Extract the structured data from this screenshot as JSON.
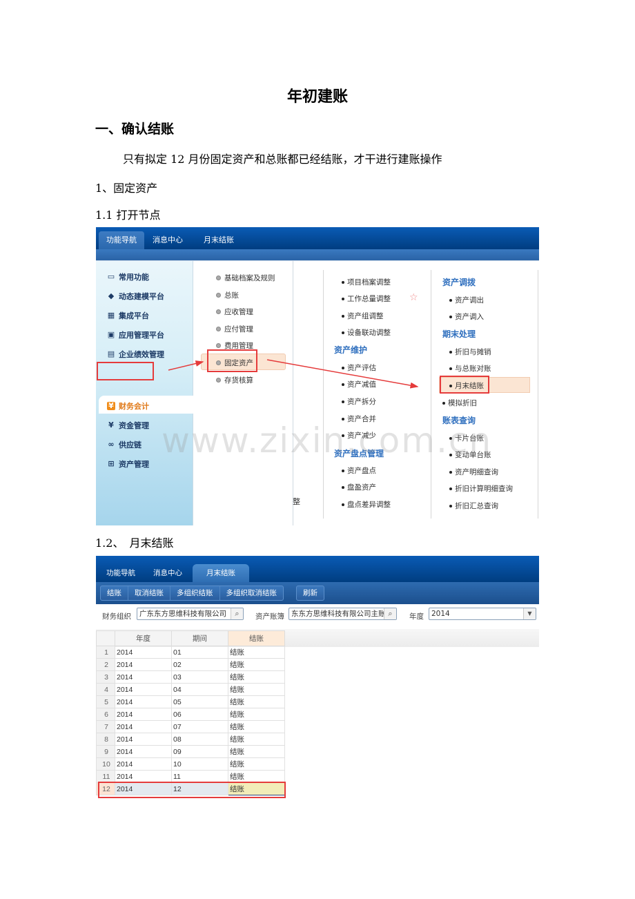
{
  "document": {
    "title": "年初建账",
    "section1": "一、确认结账",
    "intro": "只有拟定 12 月份固定资产和总账都已经结账，才干进行建账操作",
    "step1": "1、固定资产",
    "step1_1": "1.1 打开节点",
    "step1_2": "1.2、　月末结账"
  },
  "shot1": {
    "tabs": [
      "功能导航",
      "消息中心",
      "月末结账"
    ],
    "active_tab": "功能导航",
    "left_nav": [
      {
        "label": "常用功能",
        "icon": "monitor-icon"
      },
      {
        "label": "动态建模平台",
        "icon": "cube-icon"
      },
      {
        "label": "集成平台",
        "icon": "integration-icon"
      },
      {
        "label": "应用管理平台",
        "icon": "app-icon"
      },
      {
        "label": "企业绩效管理",
        "icon": "calculator-icon"
      },
      {
        "label": "财务会计",
        "icon": "yen-icon"
      },
      {
        "label": "资金管理",
        "icon": "yen-icon"
      },
      {
        "label": "供应链",
        "icon": "link-icon"
      },
      {
        "label": "资产管理",
        "icon": "asset-icon"
      }
    ],
    "active_nav": "财务会计",
    "modules": [
      "基础档案及规则",
      "总账",
      "应收管理",
      "应付管理",
      "费用管理",
      "固定资产",
      "存货核算"
    ],
    "active_module": "固定资产",
    "col3": {
      "items_top": [
        "项目档案调整",
        "工作总量调整",
        "资产组调整",
        "设备联动调整"
      ],
      "group_maintain": "资产维护",
      "maintain_items": [
        "资产评估",
        "资产减值",
        "资产拆分",
        "资产合并",
        "资产减少"
      ],
      "group_inventory": "资产盘点管理",
      "inventory_items": [
        "资产盘点",
        "盘盈资产",
        "盘点差异调整"
      ],
      "edge_text": "整"
    },
    "col4": {
      "group_transfer": "资产调拨",
      "transfer_items": [
        "资产调出",
        "资产调入"
      ],
      "group_period": "期末处理",
      "period_items": [
        "折旧与摊销",
        "与总账对账",
        "月末结账"
      ],
      "standalone": "模拟折旧",
      "group_report": "账表查询",
      "report_items": [
        "卡片台账",
        "变动单台账",
        "资产明细查询",
        "折旧计算明细查询",
        "折旧汇总查询"
      ]
    },
    "highlighted_item": "月末结账",
    "watermark": "www.zixin.com.cn"
  },
  "shot2": {
    "tabs": [
      "功能导航",
      "消息中心",
      "月末结账"
    ],
    "active_tab": "月末结账",
    "toolbar_group1": [
      "结账",
      "取消结账",
      "多组织结账",
      "多组织取消结账"
    ],
    "toolbar_refresh": "刷新",
    "filters": {
      "org_label": "财务组织",
      "org_value": "广东东方思维科技有限公司",
      "book_label": "资产账簿",
      "book_value": "东东方思维科技有限公司主账簿",
      "year_label": "年度",
      "year_value": "2014"
    },
    "columns": [
      "年度",
      "期间",
      "结账"
    ],
    "rows": [
      [
        "1",
        "2014",
        "01",
        "结账"
      ],
      [
        "2",
        "2014",
        "02",
        "结账"
      ],
      [
        "3",
        "2014",
        "03",
        "结账"
      ],
      [
        "4",
        "2014",
        "04",
        "结账"
      ],
      [
        "5",
        "2014",
        "05",
        "结账"
      ],
      [
        "6",
        "2014",
        "06",
        "结账"
      ],
      [
        "7",
        "2014",
        "07",
        "结账"
      ],
      [
        "8",
        "2014",
        "08",
        "结账"
      ],
      [
        "9",
        "2014",
        "09",
        "结账"
      ],
      [
        "10",
        "2014",
        "10",
        "结账"
      ],
      [
        "11",
        "2014",
        "11",
        "结账"
      ],
      [
        "12",
        "2014",
        "12",
        "结账"
      ]
    ],
    "selected_row": "12"
  }
}
